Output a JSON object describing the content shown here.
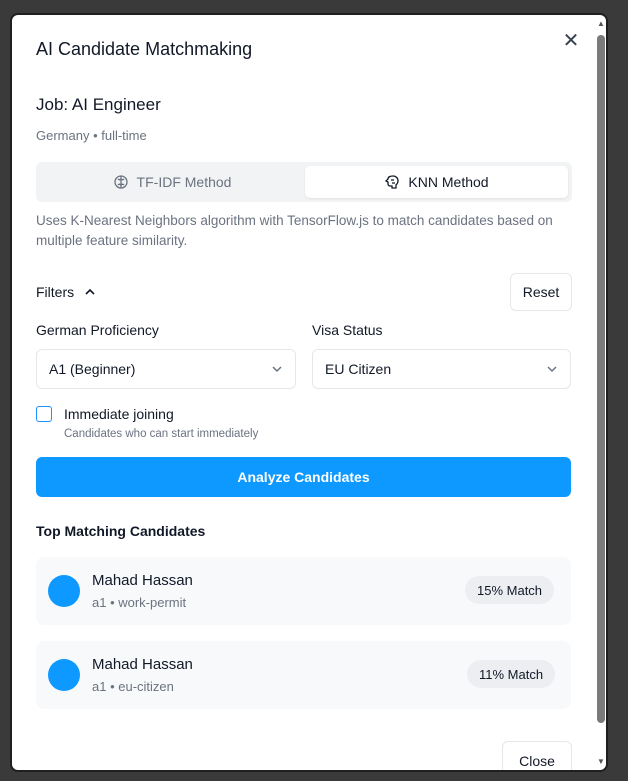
{
  "dialog": {
    "title": "AI Candidate Matchmaking",
    "close_icon": "close-icon"
  },
  "job": {
    "title": "Job: AI Engineer",
    "meta": "Germany • full-time"
  },
  "methods": [
    {
      "label": "TF-IDF Method",
      "icon": "brain-icon",
      "active": false
    },
    {
      "label": "KNN Method",
      "icon": "knn-icon",
      "active": true
    }
  ],
  "description": "Uses K-Nearest Neighbors algorithm with TensorFlow.js to match candidates based on multiple feature similarity.",
  "filters": {
    "label": "Filters",
    "reset_label": "Reset",
    "german": {
      "label": "German Proficiency",
      "value": "A1 (Beginner)"
    },
    "visa": {
      "label": "Visa Status",
      "value": "EU Citizen"
    },
    "immediate": {
      "label": "Immediate joining",
      "sublabel": "Candidates who can start immediately",
      "checked": false
    }
  },
  "analyze_label": "Analyze Candidates",
  "results": {
    "title": "Top Matching Candidates",
    "candidates": [
      {
        "name": "Mahad Hassan",
        "meta": "a1 • work-permit",
        "match": "15% Match"
      },
      {
        "name": "Mahad Hassan",
        "meta": "a1 • eu-citizen",
        "match": "11% Match"
      }
    ]
  },
  "close_label": "Close",
  "colors": {
    "accent": "#0d99ff",
    "muted": "#6b7280",
    "card_bg": "#f8f9fa"
  }
}
